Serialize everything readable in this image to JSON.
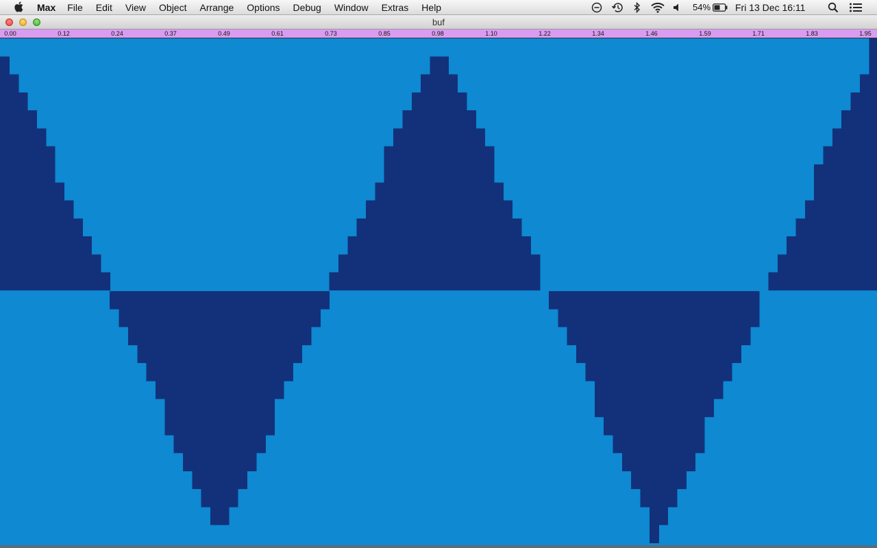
{
  "menubar": {
    "app_name": "Max",
    "items": [
      "File",
      "Edit",
      "View",
      "Object",
      "Arrange",
      "Options",
      "Debug",
      "Window",
      "Extras",
      "Help"
    ],
    "battery_percent": "54%",
    "clock": "Fri 13 Dec  16:11",
    "status_icons": [
      "do-not-disturb-icon",
      "time-machine-icon",
      "bluetooth-icon",
      "wifi-icon",
      "volume-icon",
      "battery-icon",
      "search-icon",
      "notification-center-icon"
    ]
  },
  "window": {
    "title": "buf"
  },
  "ruler": {
    "labels": [
      "0.00",
      "0.12",
      "0.24",
      "0.37",
      "0.49",
      "0.61",
      "0.73",
      "0.85",
      "0.98",
      "1.10",
      "1.22",
      "1.34",
      "1.46",
      "1.59",
      "1.71",
      "1.83",
      "1.95"
    ]
  },
  "waveform": {
    "shape": "triangle",
    "peaks": 4,
    "background_color": "#0e89d2",
    "fill_color": "#12317a",
    "ruler_color": "#d99cf2"
  }
}
